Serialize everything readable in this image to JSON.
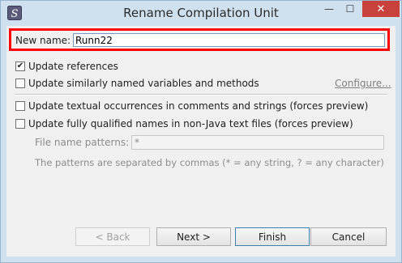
{
  "window": {
    "title": "Rename Compilation Unit",
    "app_icon": "eclipse-icon",
    "controls": {
      "minimize": "—",
      "maximize": "☐",
      "close": "✕"
    }
  },
  "form": {
    "new_name_label": "New name:",
    "new_name_value": "Runn22",
    "options": [
      {
        "label": "Update references",
        "checked": true
      },
      {
        "label": "Update similarly named variables and methods",
        "checked": false
      },
      {
        "label": "Update textual occurrences in comments and strings (forces preview)",
        "checked": false
      },
      {
        "label": "Update fully qualified names in non-Java text files (forces preview)",
        "checked": false
      }
    ],
    "configure_link": "Configure...",
    "file_name_patterns_label": "File name patterns:",
    "file_name_patterns_value": "*",
    "patterns_help": "The patterns are separated by commas (* = any string, ? = any character)"
  },
  "buttons": {
    "back": "< Back",
    "next": "Next >",
    "finish": "Finish",
    "cancel": "Cancel"
  },
  "highlight_color": "#ff0000"
}
